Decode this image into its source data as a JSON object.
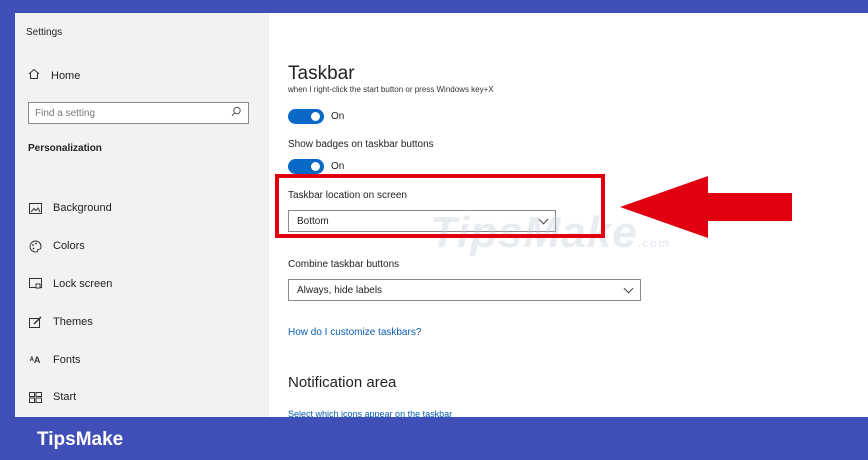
{
  "window": {
    "title": "Settings"
  },
  "sidebar": {
    "home_label": "Home",
    "search": {
      "placeholder": "Find a setting"
    },
    "section": "Personalization",
    "items": [
      {
        "label": "Background",
        "icon": "picture-icon"
      },
      {
        "label": "Colors",
        "icon": "palette-icon"
      },
      {
        "label": "Lock screen",
        "icon": "lock-screen-icon"
      },
      {
        "label": "Themes",
        "icon": "brush-icon"
      },
      {
        "label": "Fonts",
        "icon": "fonts-icon"
      },
      {
        "label": "Start",
        "icon": "start-icon"
      }
    ]
  },
  "main": {
    "title": "Taskbar",
    "cut_text": "when I right-click the start button or press Windows key+X",
    "toggle1": {
      "state": "On",
      "on": true
    },
    "badges": {
      "label": "Show badges on taskbar buttons",
      "state": "On",
      "on": true
    },
    "location": {
      "label": "Taskbar location on screen",
      "value": "Bottom"
    },
    "combine": {
      "label": "Combine taskbar buttons",
      "value": "Always, hide labels"
    },
    "help_link": "How do I customize taskbars?",
    "notification": {
      "title": "Notification area",
      "link": "Select which icons appear on the taskbar"
    }
  },
  "annotation": {
    "color": "#e1000f"
  },
  "watermark": {
    "text": "TipsMake",
    "suffix": ".com"
  },
  "banner": {
    "text": "TipsMake",
    "color": "#3f4fb7"
  }
}
